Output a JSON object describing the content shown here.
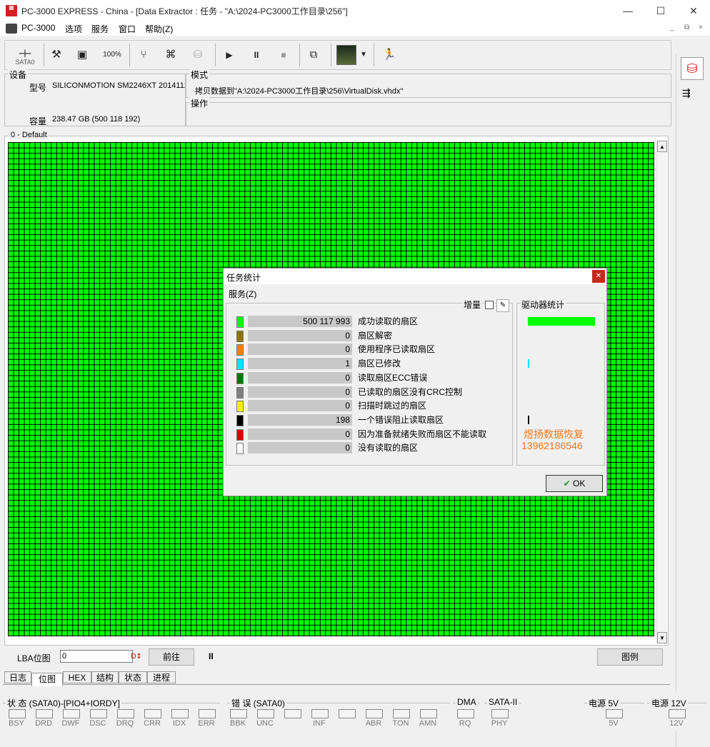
{
  "window": {
    "title": "PC-3000 EXPRESS - China - [Data Extractor : 任务 - \"A:\\2024-PC3000工作目录\\256\"]",
    "minimize_glyph": "—",
    "maximize_glyph": "☐",
    "close_glyph": "✕"
  },
  "menu": {
    "app": "PC-3000",
    "options": "选项",
    "service": "服务",
    "window": "窗口",
    "help": "帮助(Z)"
  },
  "toolbar": {
    "sata_label": "SATA0",
    "icons": [
      "sata-port-icon",
      "tools-icon",
      "drive-icon",
      "percent-icon",
      "tree-icon",
      "binoculars-icon",
      "disk-icon",
      "play-icon",
      "pause-icon",
      "stop-icon",
      "windows-icon",
      "map-view-icon",
      "dropdown-icon",
      "run-icon"
    ]
  },
  "device": {
    "group_label": "设备",
    "model_label": "型号",
    "model_value": "SILICONMOTION SM2246XT 2014112",
    "capacity_label": "容量",
    "capacity_value": "238.47 GB (500 118 192)"
  },
  "mode": {
    "group_label": "模式",
    "value": "拷贝数据到\"A:\\2024-PC3000工作目录\\256\\VirtualDisk.vhdx\""
  },
  "operation": {
    "group_label": "操作"
  },
  "map": {
    "group_label": "0 - Default",
    "lba_label": "LBA位图",
    "lba_value": "0",
    "go_button": "前往",
    "pause_glyph": "II",
    "legend_button": "图例",
    "block_color": "#00ff00"
  },
  "tabs": [
    "日志",
    "位图",
    "HEX",
    "结构",
    "状态",
    "进程"
  ],
  "active_tab": "位图",
  "dialog": {
    "title": "任务统计",
    "menu": "服务(Z)",
    "increment_label": "增量",
    "drive_stats_label": "驱动器统计",
    "watermark_name": "煜扬数据恢复",
    "watermark_phone": "13962186546",
    "ok_label": "OK",
    "rows": [
      {
        "color": "#00ff00",
        "value": "500 117 993",
        "label": "成功读取的扇区"
      },
      {
        "color": "#8b7500",
        "value": "0",
        "label": "扇区解密"
      },
      {
        "color": "#ff8000",
        "value": "0",
        "label": "使用程序已读取扇区"
      },
      {
        "color": "#00e5ff",
        "value": "1",
        "label": "扇区已修改"
      },
      {
        "color": "#007a00",
        "value": "0",
        "label": "读取扇区ECC错误"
      },
      {
        "color": "#808080",
        "value": "0",
        "label": "已读取的扇区没有CRC控制"
      },
      {
        "color": "#ffee00",
        "value": "0",
        "label": "扫描时跳过的扇区"
      },
      {
        "color": "#000000",
        "value": "198",
        "label": "一个错误阻止读取扇区"
      },
      {
        "color": "#e00000",
        "value": "0",
        "label": "因为准备就绪失败而扇区不能读取"
      },
      {
        "color": "#ffffff",
        "value": "0",
        "label": "没有读取的扇区"
      }
    ]
  },
  "status": {
    "state_group": "状 态 (SATA0)-[PIO4+IORDY]",
    "state_leds": [
      "BSY",
      "DRD",
      "DWF",
      "DSC",
      "DRQ",
      "CRR",
      "IDX",
      "ERR"
    ],
    "error_group": "错 误 (SATA0)",
    "error_leds": [
      "BBK",
      "UNC",
      "",
      "INF",
      "",
      "ABR",
      "TON",
      "AMN"
    ],
    "dma_group": "DMA",
    "dma_leds": [
      "RQ"
    ],
    "sata_group": "SATA-II",
    "sata_leds": [
      "PHY"
    ],
    "power5_group": "电源 5V",
    "power5_leds": [
      "5V"
    ],
    "power12_group": "电源 12V",
    "power12_leds": [
      "12V"
    ]
  }
}
